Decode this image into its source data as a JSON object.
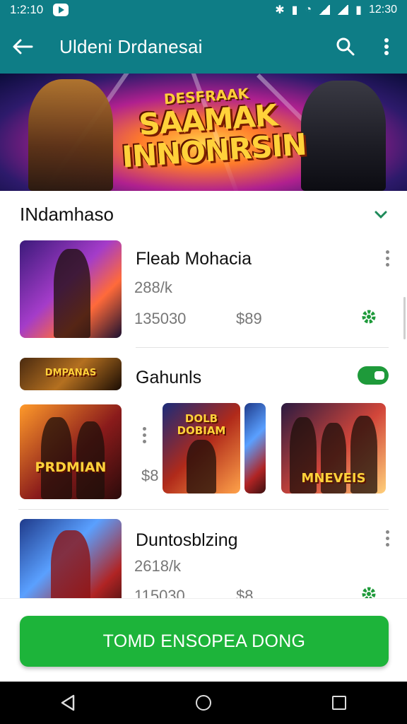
{
  "status_bar": {
    "time_left": "1:2:10",
    "time_right": "12:30"
  },
  "app_bar": {
    "title": "Uldeni Drdanesai",
    "back_icon": "arrow-left-icon",
    "search_icon": "search-icon",
    "menu_icon": "more-vert-icon"
  },
  "banner": {
    "logo_top": "DESFRAAK",
    "logo_line1": "SAAMAK",
    "logo_line2": "INNONRSIN"
  },
  "section": {
    "title": "INdamhaso"
  },
  "items": [
    {
      "title": "Fleab Mohacia",
      "rating": "288/k",
      "count": "135030",
      "price": "$89"
    },
    {
      "title": "Gahunls",
      "thumb_label": "DMPANAS"
    },
    {
      "title": "Duntosblzing",
      "rating": "2618/k",
      "count": "115030",
      "price": "$8"
    }
  ],
  "gallery": {
    "labels": [
      "PRDMIAN",
      "DOLB DOBIAM",
      "MNEVEIS"
    ],
    "price_hint": "$8"
  },
  "cta": {
    "label": "TOMD ENSOPEA DONG"
  },
  "colors": {
    "primary": "#0e7d86",
    "accent": "#1db43a",
    "text": "#111111"
  }
}
